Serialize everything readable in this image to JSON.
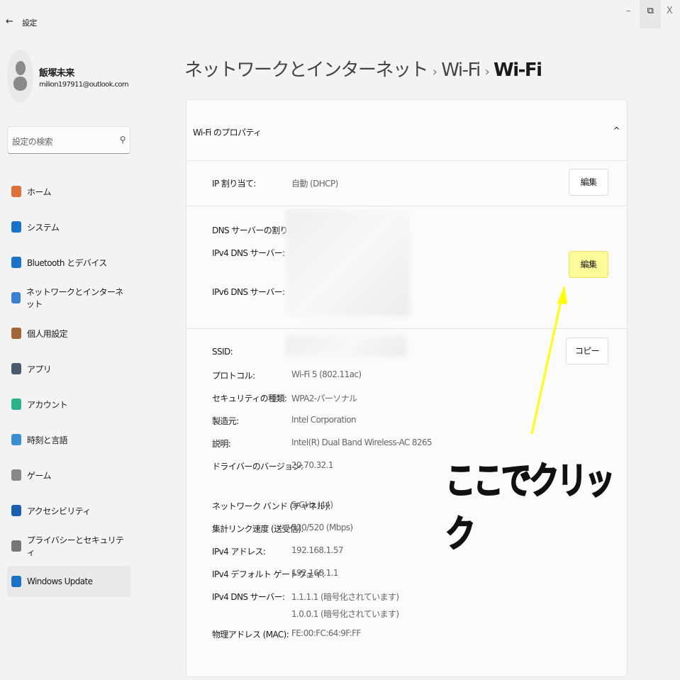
{
  "window": {
    "back_label": "←",
    "title": "設定",
    "minimize": "–",
    "restore": "⧉",
    "close": "X"
  },
  "user": {
    "name": "飯塚未来",
    "email": "milion197911@outlook.com"
  },
  "search": {
    "placeholder": "設定の検索",
    "icon": "search-icon"
  },
  "sidebar": {
    "items": [
      {
        "label": "ホーム",
        "icon": "home-icon",
        "color": "#e0703a"
      },
      {
        "label": "システム",
        "icon": "system-icon",
        "color": "#1a73c9"
      },
      {
        "label": "Bluetooth とデバイス",
        "icon": "bluetooth-icon",
        "color": "#1a73c9"
      },
      {
        "label": "ネットワークとインターネット",
        "icon": "wifi-icon",
        "color": "#3a7fd0"
      },
      {
        "label": "個人用設定",
        "icon": "brush-icon",
        "color": "#a0673a"
      },
      {
        "label": "アプリ",
        "icon": "apps-icon",
        "color": "#4a5a6a"
      },
      {
        "label": "アカウント",
        "icon": "account-icon",
        "color": "#2bb08a"
      },
      {
        "label": "時刻と言語",
        "icon": "clock-globe-icon",
        "color": "#3a8fd0"
      },
      {
        "label": "ゲーム",
        "icon": "gamepad-icon",
        "color": "#888888"
      },
      {
        "label": "アクセシビリティ",
        "icon": "accessibility-icon",
        "color": "#1a5fb0"
      },
      {
        "label": "プライバシーとセキュリティ",
        "icon": "shield-icon",
        "color": "#777777"
      },
      {
        "label": "Windows Update",
        "icon": "update-icon",
        "color": "#1a73c9",
        "selected": true
      }
    ]
  },
  "breadcrumb": {
    "part1": "ネットワークとインターネット",
    "sep": "›",
    "part2": "Wi-Fi",
    "part3": "Wi-Fi"
  },
  "card": {
    "title": "Wi-Fi のプロパティ",
    "collapse": "^",
    "ip": {
      "label": "IP 割り当て:",
      "value": "自動 (DHCP)",
      "button": "編集"
    },
    "dns": {
      "label": "DNS サーバーの割り当て:",
      "ipv4": "IPv4 DNS サーバー:",
      "ipv6": "IPv6 DNS サーバー:",
      "button": "編集"
    },
    "copy_button": "コピー",
    "props": [
      {
        "label": "SSID:",
        "value": ""
      },
      {
        "label": "プロトコル:",
        "value": "Wi-Fi 5 (802.11ac)"
      },
      {
        "label": "セキュリティの種類:",
        "value": "WPA2-パーソナル"
      },
      {
        "label": "製造元:",
        "value": "Intel Corporation"
      },
      {
        "label": "説明:",
        "value": "Intel(R) Dual Band Wireless-AC 8265"
      },
      {
        "label": "ドライバーのバージョン:",
        "value": "20.70.32.1"
      }
    ],
    "props2": [
      {
        "label": "ネットワーク バンド (チャネル):",
        "value": "5 GHz (44)"
      },
      {
        "label": "集計リンク速度 (送受信):",
        "value": "520/520 (Mbps)"
      },
      {
        "label": "IPv4 アドレス:",
        "value": "192.168.1.57"
      },
      {
        "label": "IPv4 デフォルト ゲートウェイ:",
        "value": "192.168.1.1"
      },
      {
        "label": "IPv4 DNS サーバー:",
        "value": "1.1.1.1 (暗号化されています)",
        "value2": "1.0.0.1 (暗号化されています)"
      },
      {
        "label": "物理アドレス (MAC):",
        "value": "FE:00:FC:64:9F:FF"
      }
    ]
  },
  "annotation": {
    "text": "ここでクリック",
    "color": "#ffff00"
  }
}
